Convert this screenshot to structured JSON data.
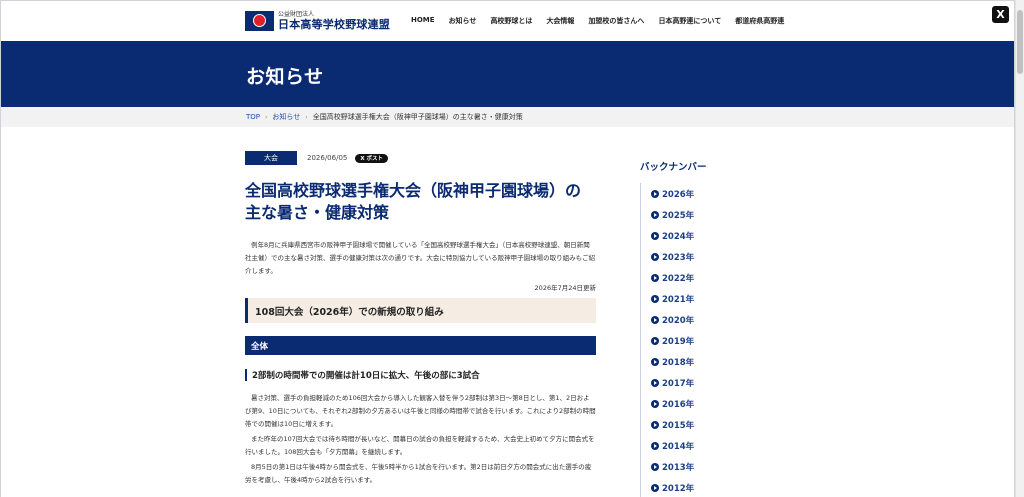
{
  "header": {
    "org_small": "公益財団法人",
    "org_name": "日本高等学校野球連盟",
    "nav": [
      "HOME",
      "お知らせ",
      "高校野球とは",
      "大会情報",
      "加盟校の皆さんへ",
      "日本高野連について",
      "都道府県高野連"
    ],
    "x_label": "X"
  },
  "banner": {
    "title": "お知らせ"
  },
  "breadcrumb": {
    "items": [
      "TOP",
      "お知らせ"
    ],
    "current": "全国高校野球選手権大会（阪神甲子園球場）の主な暑さ・健康対策"
  },
  "article": {
    "category": "大会",
    "date": "2026/06/05",
    "post_button": "X ポスト",
    "title": "全国高校野球選手権大会（阪神甲子園球場）の主な暑さ・健康対策",
    "lead": "例年8月に兵庫県西宮市の阪神甲子園球場で開催している「全国高校野球選手権大会」（日本高校野球連盟、朝日新聞社主催）での主な暑さ対策、選手の健康対策は次の通りです。大会に特別協力している阪神甲子園球場の取り組みもご紹介します。",
    "updated": "2026年7月24日更新",
    "section_heading": "108回大会（2026年）での新規の取り組み",
    "bar_heading": "全体",
    "sub_heading": "2部制の時間帯での開催は計10日に拡大、午後の部に3試合",
    "paragraphs": [
      "暑さ対策、選手の負担軽減のため106回大会から導入した観客入替を伴う2部制は第3日〜第8日とし、第1、2日および第9、10日についても、それぞれ2部制の夕方あるいは午後と同様の時間帯で試合を行います。これにより2部制の時間帯での開催は10日に増えます。",
      "また昨年の107回大会では待ち時間が長いなど、開幕日の試合の負担を軽減するため、大会史上初めて夕方に開会式を行いました。108回大会も「夕方開幕」を継続します。",
      "8月5日の第1日は午後4時から開会式を、午後5時半から1試合を行います。第2日は前日夕方の開会式に出た選手の疲労を考慮し、午後4時から2試合を行います。"
    ]
  },
  "sidebar": {
    "heading": "バックナンバー",
    "years": [
      "2026年",
      "2025年",
      "2024年",
      "2023年",
      "2022年",
      "2021年",
      "2020年",
      "2019年",
      "2018年",
      "2017年",
      "2016年",
      "2015年",
      "2014年",
      "2013年",
      "2012年"
    ]
  },
  "colors": {
    "brand_navy": "#0a2a72",
    "heading_bg": "#f5ede4",
    "breadcrumb_bg": "#f2f2f2",
    "logo_red": "#e41f2c"
  },
  "icons": {
    "logo": "jhbf-logo-icon",
    "x": "x-logo-icon",
    "year_bullet": "circle-chevron-right-icon"
  }
}
